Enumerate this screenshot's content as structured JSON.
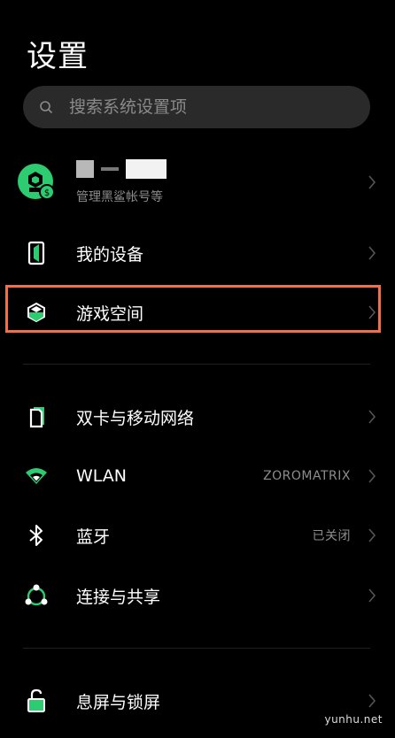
{
  "title": "设置",
  "search": {
    "placeholder": "搜索系统设置项"
  },
  "account": {
    "subtitle": "管理黑鲨帐号等"
  },
  "items": [
    {
      "label": "我的设备"
    },
    {
      "label": "游戏空间"
    },
    {
      "label": "双卡与移动网络"
    },
    {
      "label": "WLAN",
      "value": "ZOROMATRIX"
    },
    {
      "label": "蓝牙",
      "value": "已关闭"
    },
    {
      "label": "连接与共享"
    },
    {
      "label": "息屏与锁屏"
    }
  ],
  "watermark": "yunhu.net",
  "colors": {
    "accent": "#2ecc71",
    "highlight": "#f1704a",
    "background": "#000000"
  }
}
